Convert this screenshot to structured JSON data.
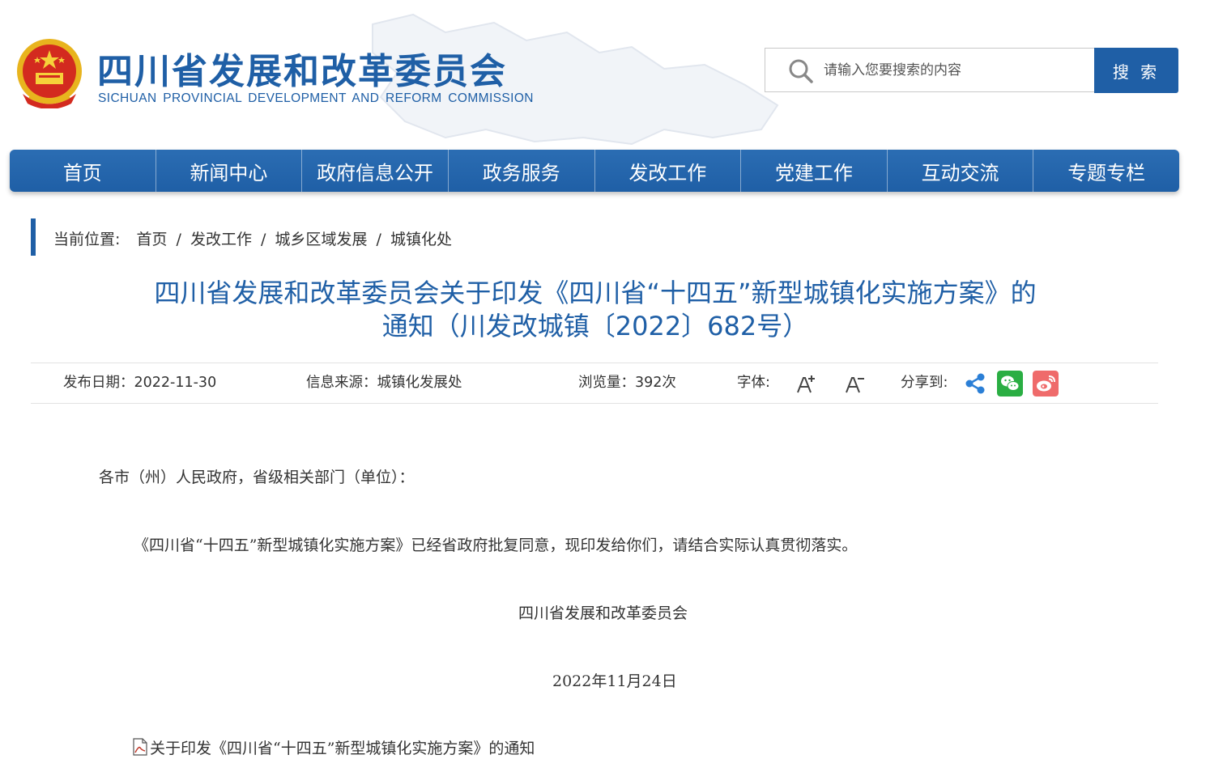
{
  "header": {
    "site_title": "四川省发展和改革委员会",
    "site_subtitle": "SICHUAN PROVINCIAL DEVELOPMENT AND REFORM COMMISSION",
    "search_placeholder": "请输入您要搜索的内容",
    "search_button": "搜 索",
    "brand_color": "#1f5fa6"
  },
  "nav": {
    "items": [
      "首页",
      "新闻中心",
      "政府信息公开",
      "政务服务",
      "发改工作",
      "党建工作",
      "互动交流",
      "专题专栏"
    ]
  },
  "breadcrumb": {
    "label": "当前位置:",
    "items": [
      "首页",
      "发改工作",
      "城乡区域发展",
      "城镇化处"
    ],
    "separator": "/"
  },
  "article": {
    "title_line1": "四川省发展和改革委员会关于印发《四川省“十四五”新型城镇化实施方案》的",
    "title_line2": "通知（川发改城镇〔2022〕682号）",
    "meta": {
      "date": "发布日期：2022-11-30",
      "source": "信息来源：城镇化发展处",
      "views": "浏览量：392次",
      "font_label": "字体:",
      "share_label": "分享到:"
    },
    "salutation": "各市（州）人民政府，省级相关部门（单位）：",
    "paragraph": "《四川省“十四五”新型城镇化实施方案》已经省政府批复同意，现印发给你们，请结合实际认真贯彻落实。",
    "signature": "四川省发展和改革委员会",
    "sign_date": "2022年11月24日",
    "attachment": "关于印发《四川省“十四五”新型城镇化实施方案》的通知"
  },
  "icons": {
    "font_increase": "font-increase-icon",
    "font_decrease": "font-decrease-icon",
    "share": "share-icon",
    "wechat": "wechat-icon",
    "weibo": "weibo-icon",
    "attachment": "pdf-file-icon",
    "wechat_color": "#2aae43",
    "weibo_color": "#ef6b6b",
    "share_color": "#2b7fd6"
  }
}
